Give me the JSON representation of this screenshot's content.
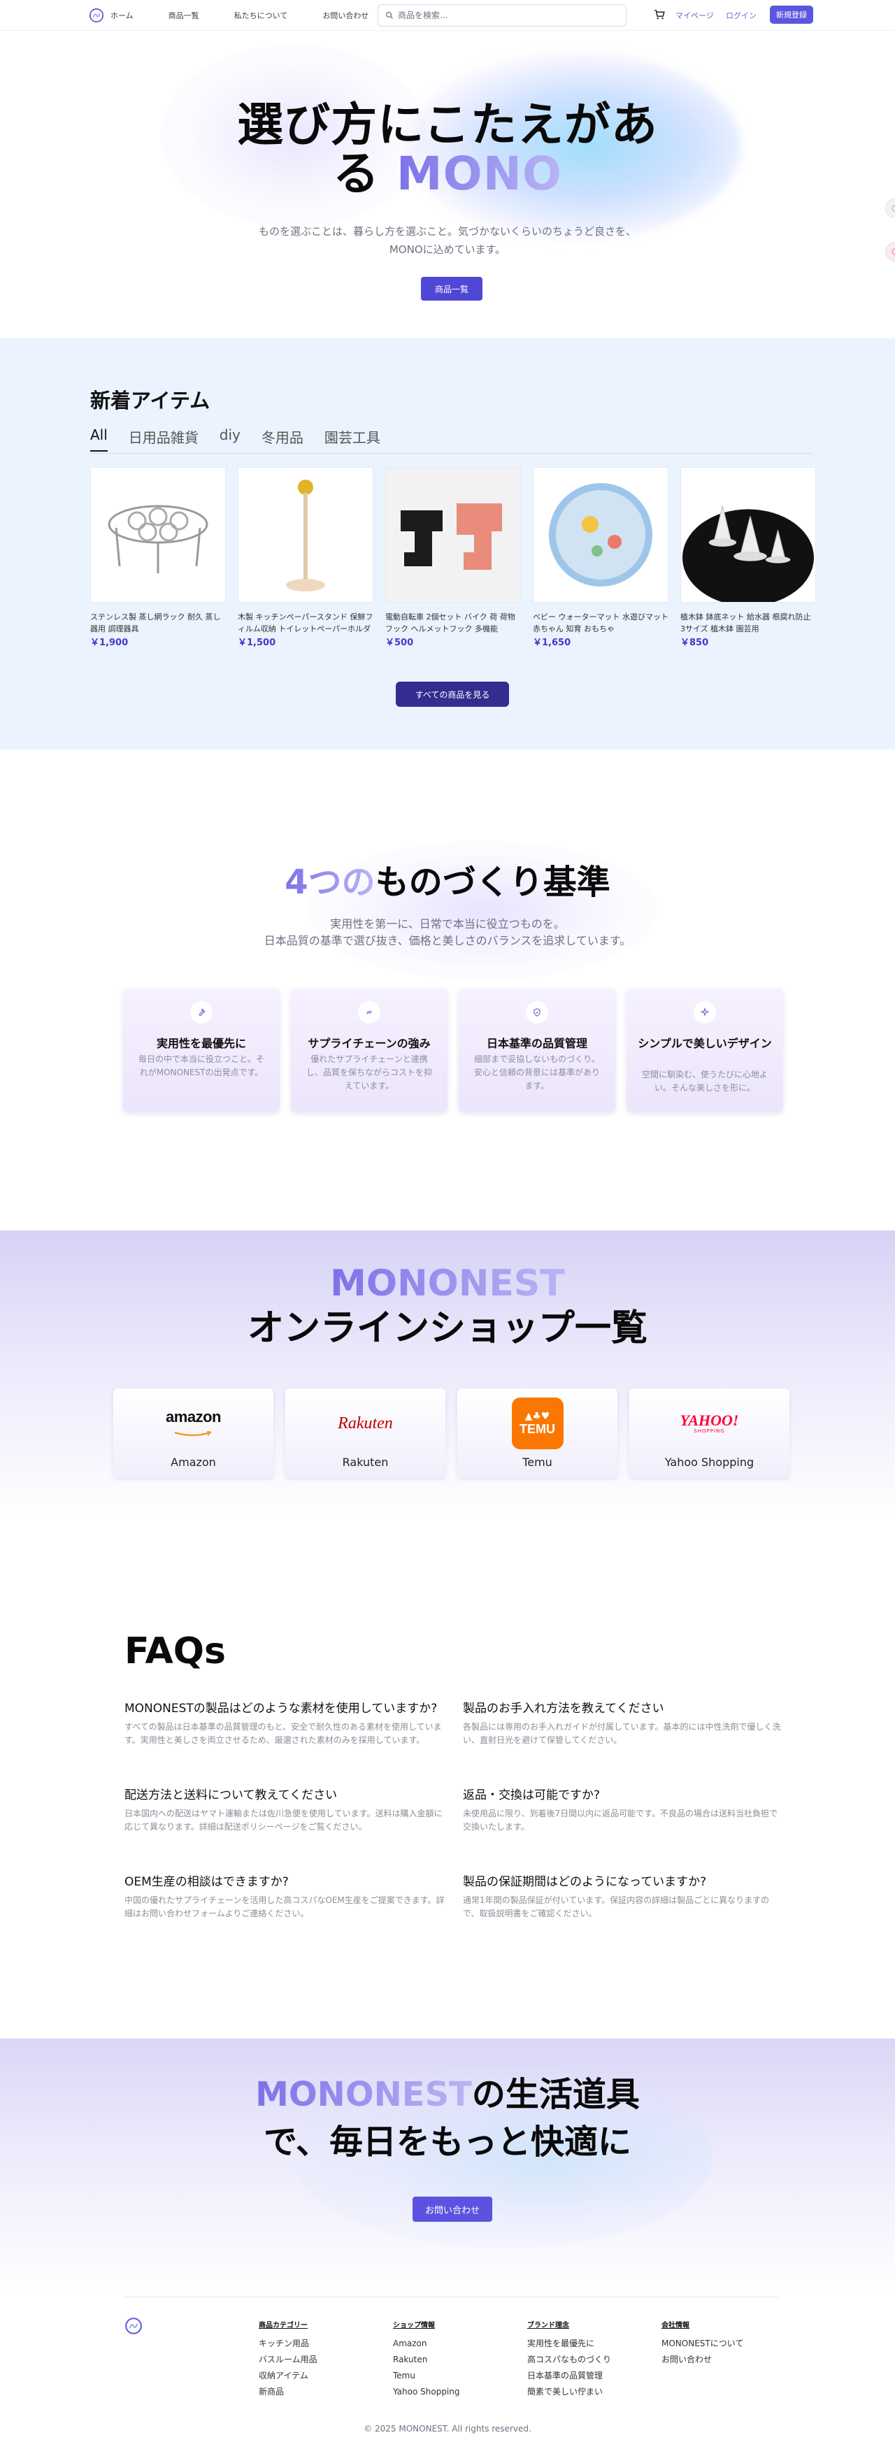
{
  "header": {
    "nav": [
      "ホーム",
      "商品一覧",
      "私たちについて",
      "お問い合わせ"
    ],
    "search_placeholder": "商品を検索...",
    "mypage": "マイページ",
    "login": "ログイン",
    "signup": "新規登録"
  },
  "hero": {
    "title_line1": "選び方にこたえがあ",
    "title_line2_a": "る",
    "title_line2_b": "MONO",
    "subtitle_line1": "ものを選ぶことは、暮らし方を選ぶこと。気づかないくらいのちょうど良さを、",
    "subtitle_line2": "MONOに込めています。",
    "button": "商品一覧"
  },
  "new_items": {
    "title": "新着アイテム",
    "tabs": [
      "All",
      "日用品雑貨",
      "diy",
      "冬用品",
      "園芸工具"
    ],
    "active_tab": "All",
    "products": [
      {
        "name": "ステンレス製 蒸し網ラック 耐久 蒸し器用 調理器具",
        "price": "￥1,900"
      },
      {
        "name": "木製 キッチンペーパースタンド 保鮮フィルム収納 トイレットペーパーホルダー",
        "price": "￥1,500"
      },
      {
        "name": "電動自転車 2個セット バイク 荷 荷物フック ヘルメットフック 多機能",
        "price": "￥500"
      },
      {
        "name": "ベビー ウォーターマット 水遊びマット 赤ちゃん 知育 おもちゃ",
        "price": "￥1,650"
      },
      {
        "name": "植木鉢 鉢底ネット 給水器 根腐れ防止 3サイズ 植木鉢 園芸用",
        "price": "￥850"
      }
    ],
    "view_all": "すべての商品を見る"
  },
  "criteria": {
    "title_a": "4つの",
    "title_b": "ものづくり基準",
    "subtitle_line1": "実用性を第一に、日常で本当に役立つものを。",
    "subtitle_line2": "日本品質の基準で選び抜き、価格と美しさのバランスを追求しています。",
    "cards": [
      {
        "icon": "wrench-icon",
        "title": "実用性を最優先に",
        "desc": "毎日の中で本当に役立つこと。それがMONONESTの出発点です。"
      },
      {
        "icon": "link-icon",
        "title": "サプライチェーンの強み",
        "desc": "優れたサプライチェーンと連携し、品質を保ちながらコストを抑えています。"
      },
      {
        "icon": "shield-icon",
        "title": "日本基準の品質管理",
        "desc": "細部まで妥協しないものづくり。安心と信頼の背景には基準があります。"
      },
      {
        "icon": "sparkle-icon",
        "title": "シンプルで美しいデザイン",
        "desc": "空間に馴染む、使うたびに心地よい。そんな美しさを形に。"
      }
    ]
  },
  "shops": {
    "title_a": "MONONEST",
    "title_b": "オンラインショップ一覧",
    "items": [
      {
        "logo": "amazon",
        "name": "Amazon"
      },
      {
        "logo": "Rakuten",
        "name": "Rakuten"
      },
      {
        "logo": "TEMU",
        "name": "Temu"
      },
      {
        "logo": "YAHOO!",
        "logo_sub": "SHOPPING",
        "name": "Yahoo Shopping"
      }
    ]
  },
  "faq": {
    "title": "FAQs",
    "items": [
      {
        "q": "MONONESTの製品はどのような素材を使用していますか?",
        "a": "すべての製品は日本基準の品質管理のもと、安全で耐久性のある素材を使用しています。実用性と美しさを両立させるため、厳選された素材のみを採用しています。"
      },
      {
        "q": "製品のお手入れ方法を教えてください",
        "a": "各製品には専用のお手入れガイドが付属しています。基本的には中性洗剤で優しく洗い、直射日光を避けて保管してください。"
      },
      {
        "q": "配送方法と送料について教えてください",
        "a": "日本国内への配送はヤマト運輸または佐川急便を使用しています。送料は購入金額に応じて異なります。詳細は配送ポリシーページをご覧ください。"
      },
      {
        "q": "返品・交換は可能ですか?",
        "a": "未使用品に限り、到着後7日間以内に返品可能です。不良品の場合は送料当社負担で交換いたします。"
      },
      {
        "q": "OEM生産の相談はできますか?",
        "a": "中国の優れたサプライチェーンを活用した高コスパなOEM生産をご提案できます。詳細はお問い合わせフォームよりご連絡ください。"
      },
      {
        "q": "製品の保証期間はどのようになっていますか?",
        "a": "通常1年間の製品保証が付いています。保証内容の詳細は製品ごとに異なりますので、取扱説明書をご確認ください。"
      }
    ]
  },
  "cta": {
    "title_a": "MONONEST",
    "title_b": "の生活道具",
    "title_line2": "で、毎日をもっと快適に",
    "button": "お問い合わせ"
  },
  "footer": {
    "columns": [
      {
        "heading": "商品カテゴリー",
        "links": [
          "キッチン用品",
          "バスルーム用品",
          "収納アイテム",
          "新商品"
        ]
      },
      {
        "heading": "ショップ情報",
        "links": [
          "Amazon",
          "Rakuten",
          "Temu",
          "Yahoo Shopping"
        ]
      },
      {
        "heading": "ブランド理念",
        "links": [
          "実用性を最優先に",
          "高コスパなものづくり",
          "日本基準の品質管理",
          "簡素で美しい佇まい"
        ]
      },
      {
        "heading": "会社情報",
        "links": [
          "MONONESTについて",
          "お問い合わせ"
        ]
      }
    ],
    "copyright": "© 2025 MONONEST. All rights reserved."
  },
  "colors": {
    "accent": "#5b56e0",
    "price": "#4338ca",
    "new_items_bg": "#eaf3fe"
  }
}
